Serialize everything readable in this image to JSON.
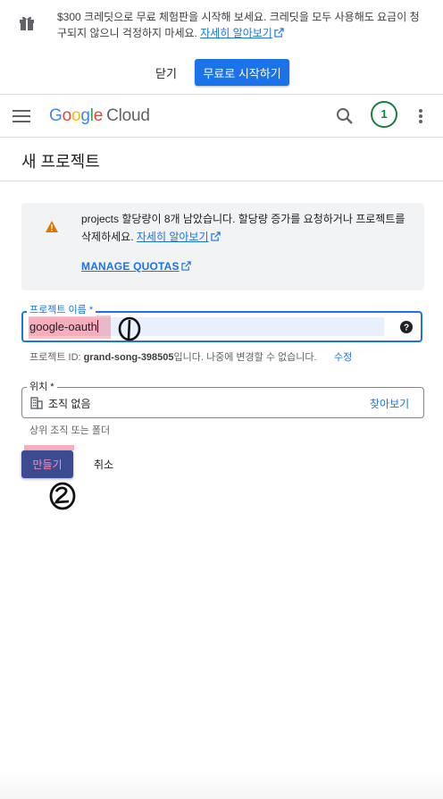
{
  "banner": {
    "text": "$300 크레딧으로 무료 체험판을 시작해 보세요. 크레딧을 모두 사용해도 요금이 청구되지 않으니 걱정하지 마세요.",
    "link": "자세히 알아보기",
    "close_label": "닫기",
    "start_label": "무료로 시작하기"
  },
  "header": {
    "logo_g": "G",
    "logo_o1": "o",
    "logo_o2": "o",
    "logo_g2": "g",
    "logo_l": "l",
    "logo_e": "e",
    "logo_cloud": "Cloud",
    "avatar": "1"
  },
  "page": {
    "title": "새 프로젝트"
  },
  "quota": {
    "text": "projects 할당량이 8개 남았습니다. 할당량 증가를 요청하거나 프로젝트를 삭제하세요.",
    "link": "자세히 알아보기",
    "manage": "MANAGE QUOTAS"
  },
  "form": {
    "name_label": "프로젝트 이름 *",
    "name_value": "google-oauth",
    "project_id_prefix": "프로젝트 ID: ",
    "project_id": "grand-song-398505",
    "project_id_suffix": "입니다. 나중에 변경할 수 없습니다.",
    "edit_label": "수정",
    "location_label": "위치 *",
    "location_value": "조직 없음",
    "browse_label": "찾아보기",
    "location_hint": "상위 조직 또는 폴더",
    "create_label": "만들기",
    "cancel_label": "취소"
  },
  "colors": {
    "accent": "#1a73e8",
    "avatar": "#188038",
    "warning": "#e37400",
    "highlight": "#f0506e"
  },
  "icons": [
    "gift-icon",
    "external-link-icon",
    "menu-icon",
    "search-icon",
    "more-vert-icon",
    "warning-icon",
    "help-icon",
    "organization-icon"
  ],
  "annotations": {
    "mark1": "1",
    "mark2": "2"
  }
}
